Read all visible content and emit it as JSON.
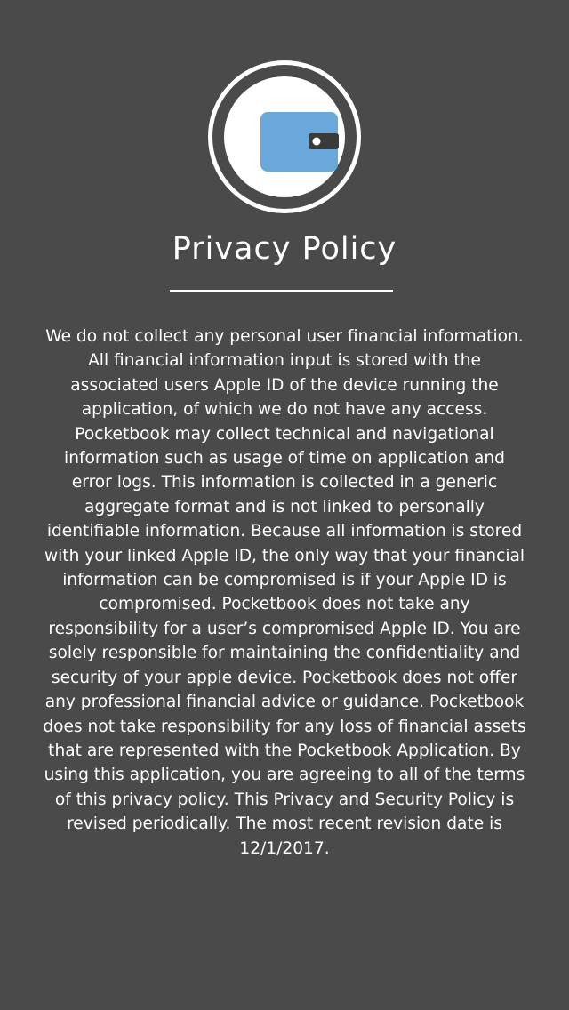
{
  "header": {
    "logo_icon": "wallet-icon",
    "logo_color": "#6aa8dc",
    "title": "Privacy Policy"
  },
  "policy": {
    "body": "We do not collect any personal user financial information. All financial information input is stored with the associated users Apple ID of the device running the application, of which we do not have any access. Pocketbook may collect technical and navigational information such as usage of time on application and error logs. This information is collected in a generic aggregate format and is not linked to personally identifiable information. Because all information is stored with your linked Apple ID, the only way that your financial information can be compromised is if your Apple ID is compromised. Pocketbook does not take any responsibility for a user’s compromised Apple ID. You are solely responsible for maintaining the confidentiality and security of your apple device. Pocketbook does not offer any professional financial advice or guidance. Pocketbook does not take responsibility for any loss of financial assets that are represented with the Pocketbook Application. By using this application, you are agreeing to all of the terms of this privacy policy. This Privacy and Security Policy is revised periodically. The most recent revision date is 12/1/2017."
  },
  "theme": {
    "background": "#4a4a4a",
    "foreground": "#ffffff",
    "accent": "#6aa8dc"
  }
}
